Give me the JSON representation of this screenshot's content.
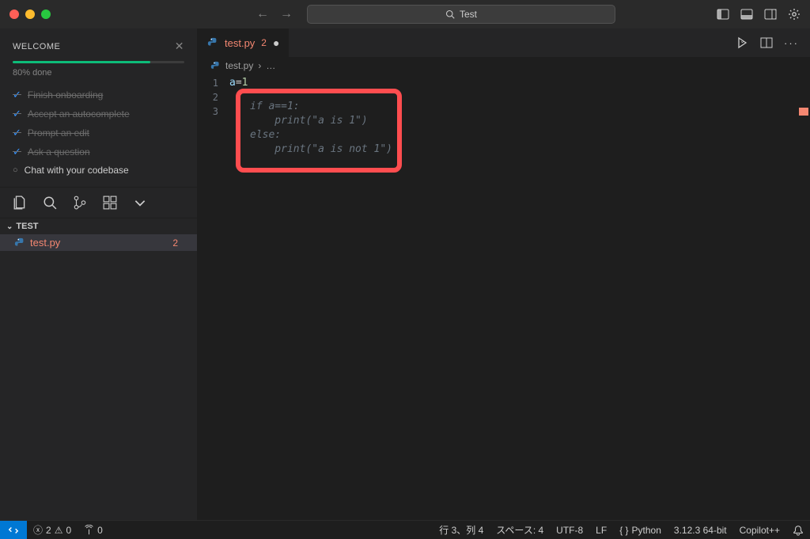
{
  "titlebar": {
    "search_text": "Test"
  },
  "welcome": {
    "title": "WELCOME",
    "progress_percent": 80,
    "progress_text": "80% done",
    "items": [
      {
        "label": "Finish onboarding",
        "done": true
      },
      {
        "label": "Accept an autocomplete",
        "done": true
      },
      {
        "label": "Prompt an edit",
        "done": true
      },
      {
        "label": "Ask a question",
        "done": true
      },
      {
        "label": "Chat with your codebase",
        "done": false
      }
    ]
  },
  "explorer": {
    "root_name": "TEST",
    "file": {
      "name": "test.py",
      "problems": "2"
    }
  },
  "tab": {
    "name": "test.py",
    "problems": "2"
  },
  "breadcrumb": {
    "file": "test.py",
    "separator": "›",
    "trail": "…"
  },
  "code": {
    "lines": [
      {
        "n": "1",
        "html": "a=1"
      },
      {
        "n": "2",
        "html": ""
      },
      {
        "n": "3",
        "html": ""
      }
    ],
    "ghost": {
      "l1": "if a==1:",
      "l2": "    print(\"a is 1\")",
      "l3": "else:",
      "l4": "    print(\"a is not 1\")"
    }
  },
  "statusbar": {
    "errors": "2",
    "warnings": "0",
    "ports": "0",
    "cursor": "行 3、列 4",
    "spaces": "スペース: 4",
    "encoding": "UTF-8",
    "eol": "LF",
    "language": "Python",
    "interpreter": "3.12.3 64-bit",
    "copilot": "Copilot++"
  }
}
